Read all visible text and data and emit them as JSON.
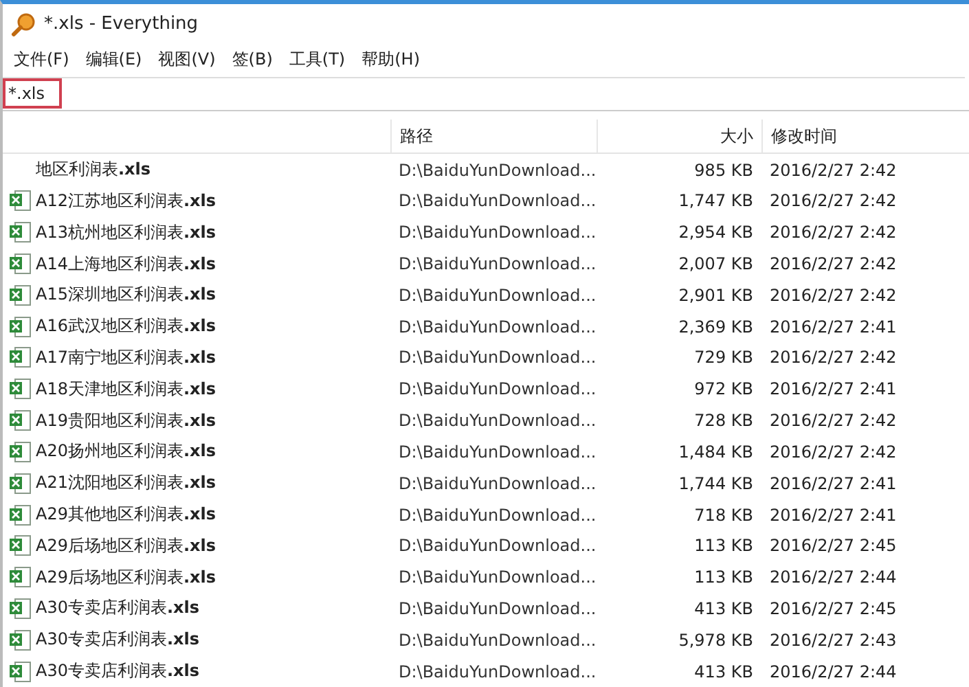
{
  "window": {
    "title": "*.xls - Everything"
  },
  "menu": [
    "文件(F)",
    "编辑(E)",
    "视图(V)",
    "签(B)",
    "工具(T)",
    "帮助(H)"
  ],
  "search": {
    "value": "*.xls"
  },
  "table": {
    "columns": [
      {
        "label": "路径"
      },
      {
        "label": "大小"
      },
      {
        "label": "修改时间"
      }
    ],
    "rows": [
      {
        "name": "地区利润表**.xls**",
        "path": "D:\\BaiduYunDownload...",
        "size": "985 KB",
        "modified": "2016/2/27 2:42",
        "icon": false
      },
      {
        "name": "A12江苏地区利润表**.xls**",
        "path": "D:\\BaiduYunDownload...",
        "size": "1,747 KB",
        "modified": "2016/2/27 2:42",
        "icon": true
      },
      {
        "name": "A13杭州地区利润表**.xls**",
        "path": "D:\\BaiduYunDownload...",
        "size": "2,954 KB",
        "modified": "2016/2/27 2:42",
        "icon": true
      },
      {
        "name": "A14上海地区利润表**.xls**",
        "path": "D:\\BaiduYunDownload...",
        "size": "2,007 KB",
        "modified": "2016/2/27 2:42",
        "icon": true
      },
      {
        "name": "A15深圳地区利润表**.xls**",
        "path": "D:\\BaiduYunDownload...",
        "size": "2,901 KB",
        "modified": "2016/2/27 2:42",
        "icon": true
      },
      {
        "name": "A16武汉地区利润表**.xls**",
        "path": "D:\\BaiduYunDownload...",
        "size": "2,369 KB",
        "modified": "2016/2/27 2:41",
        "icon": true
      },
      {
        "name": "A17南宁地区利润表**.xls**",
        "path": "D:\\BaiduYunDownload...",
        "size": "729 KB",
        "modified": "2016/2/27 2:42",
        "icon": true
      },
      {
        "name": "A18天津地区利润表**.xls**",
        "path": "D:\\BaiduYunDownload...",
        "size": "972 KB",
        "modified": "2016/2/27 2:41",
        "icon": true
      },
      {
        "name": "A19贵阳地区利润表**.xls**",
        "path": "D:\\BaiduYunDownload...",
        "size": "728 KB",
        "modified": "2016/2/27 2:42",
        "icon": true
      },
      {
        "name": "A20扬州地区利润表**.xls**",
        "path": "D:\\BaiduYunDownload...",
        "size": "1,484 KB",
        "modified": "2016/2/27 2:42",
        "icon": true
      },
      {
        "name": "A21沈阳地区利润表**.xls**",
        "path": "D:\\BaiduYunDownload...",
        "size": "1,744 KB",
        "modified": "2016/2/27 2:41",
        "icon": true
      },
      {
        "name": "A29其他地区利润表**.xls**",
        "path": "D:\\BaiduYunDownload...",
        "size": "718 KB",
        "modified": "2016/2/27 2:41",
        "icon": true
      },
      {
        "name": "A29后场地区利润表**.xls**",
        "path": "D:\\BaiduYunDownload...",
        "size": "113 KB",
        "modified": "2016/2/27 2:45",
        "icon": true
      },
      {
        "name": "A29后场地区利润表**.xls**",
        "path": "D:\\BaiduYunDownload...",
        "size": "113 KB",
        "modified": "2016/2/27 2:44",
        "icon": true
      },
      {
        "name": "A30专卖店利润表**.xls**",
        "path": "D:\\BaiduYunDownload...",
        "size": "413 KB",
        "modified": "2016/2/27 2:45",
        "icon": true
      },
      {
        "name": "A30专卖店利润表**.xls**",
        "path": "D:\\BaiduYunDownload...",
        "size": "5,978 KB",
        "modified": "2016/2/27 2:43",
        "icon": true
      },
      {
        "name": "A30专卖店利润表**.xls**",
        "path": "D:\\BaiduYunDownload...",
        "size": "413 KB",
        "modified": "2016/2/27 2:44",
        "icon": true
      }
    ]
  }
}
